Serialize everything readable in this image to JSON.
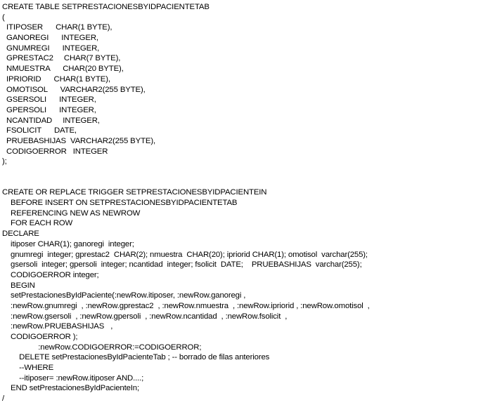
{
  "document": {
    "lines": [
      "CREATE TABLE SETPRESTACIONESBYIDPACIENTETAB",
      "(",
      "  ITIPOSER      CHAR(1 BYTE),",
      "  GANOREGI      INTEGER,",
      "  GNUMREGI      INTEGER,",
      "  GPRESTAC2     CHAR(7 BYTE),",
      "  NMUESTRA      CHAR(20 BYTE),",
      "  IPRIORID      CHAR(1 BYTE),",
      "  OMOTISOL      VARCHAR2(255 BYTE),",
      "  GSERSOLI      INTEGER,",
      "  GPERSOLI      INTEGER,",
      "  NCANTIDAD     INTEGER,",
      "  FSOLICIT      DATE,",
      "  PRUEBASHIJAS  VARCHAR2(255 BYTE),",
      "  CODIGOERROR   INTEGER",
      ");",
      "",
      "",
      "CREATE OR REPLACE TRIGGER SETPRESTACIONESBYIDPACIENTEIN",
      "    BEFORE INSERT ON SETPRESTACIONESBYIDPACIENTETAB",
      "    REFERENCING NEW AS NEWROW",
      "    FOR EACH ROW",
      "DECLARE",
      "    itiposer CHAR(1); ganoregi  integer;",
      "    gnumregi  integer; gprestac2  CHAR(2); nmuestra  CHAR(20); ipriorid CHAR(1); omotisol  varchar(255);",
      "    gsersoli  integer; gpersoli  integer; ncantidad  integer; fsolicit  DATE;    PRUEBASHIJAS  varchar(255);",
      "    CODIGOERROR integer;",
      "    BEGIN",
      "    setPrestacionesByIdPaciente(:newRow.itiposer, :newRow.ganoregi ,",
      "    :newRow.gnumregi  , :newRow.gprestac2  , :newRow.nmuestra  , :newRow.ipriorid , :newRow.omotisol  ,",
      "    :newRow.gsersoli  , :newRow.gpersoli  , :newRow.ncantidad  , :newRow.fsolicit  ,",
      "    :newRow.PRUEBASHIJAS   ,",
      "    CODIGOERROR );",
      "                 :newRow.CODIGOERROR:=CODIGOERROR;",
      "        DELETE setPrestacionesByIdPacienteTab ; -- borrado de filas anteriores",
      "        --WHERE",
      "        --itiposer= :newRow.itiposer AND....;",
      "    END setPrestacionesByIdPacienteIn;",
      "/"
    ]
  }
}
